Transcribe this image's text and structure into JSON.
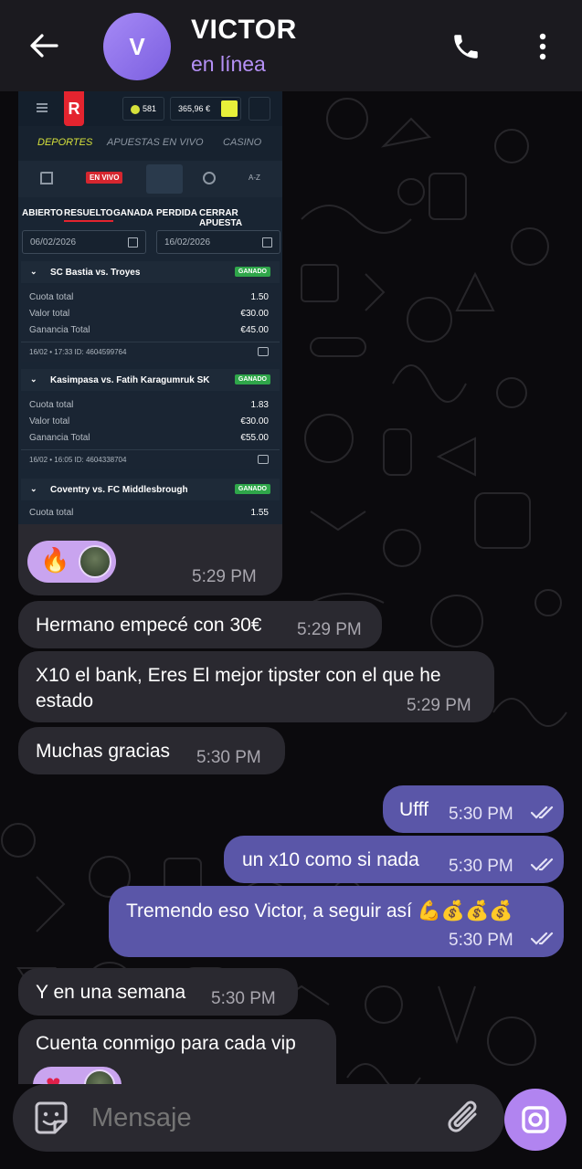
{
  "header": {
    "contact_name": "VICTOR",
    "status": "en línea",
    "avatar_initial": "V"
  },
  "screenshot": {
    "balance_points": "581",
    "balance_amount": "365,96 €",
    "nav": [
      "DEPORTES",
      "APUESTAS EN VIVO",
      "CASINO"
    ],
    "live_label": "EN VIVO",
    "az_label": "A-Z",
    "filters": [
      "ABIERTO",
      "RESUELTO",
      "GANADA",
      "PERDIDA",
      "CERRAR APUESTA"
    ],
    "date_from": "06/02/2026",
    "date_to": "16/02/2026",
    "bets": [
      {
        "match": "SC Bastia vs. Troyes",
        "status": "GANADO",
        "rows": [
          [
            "Cuota total",
            "1.50"
          ],
          [
            "Valor total",
            "€30.00"
          ],
          [
            "Ganancia Total",
            "€45.00"
          ]
        ],
        "meta": "16/02 • 17:33   ID: 4604599764"
      },
      {
        "match": "Kasimpasa vs. Fatih Karagumruk SK",
        "status": "GANADO",
        "rows": [
          [
            "Cuota total",
            "1.83"
          ],
          [
            "Valor total",
            "€30.00"
          ],
          [
            "Ganancia Total",
            "€55.00"
          ]
        ],
        "meta": "16/02 • 16:05   ID: 4604338704"
      },
      {
        "match": "Coventry vs. FC Middlesbrough",
        "status": "GANADO",
        "rows": [
          [
            "Cuota total",
            "1.55"
          ]
        ]
      }
    ]
  },
  "messages": {
    "image_time": "5:29 PM",
    "m1": {
      "text": "Hermano empecé con 30€",
      "time": "5:29 PM"
    },
    "m2": {
      "text": "X10 el bank, Eres El mejor tipster con el que he estado",
      "time": "5:29 PM"
    },
    "m3": {
      "text": "Muchas gracias",
      "time": "5:30 PM"
    },
    "m4": {
      "text": "Ufff",
      "time": "5:30 PM"
    },
    "m5": {
      "text": "un x10 como si nada",
      "time": "5:30 PM"
    },
    "m6": {
      "text": "Tremendo eso Victor, a seguir así 💪💰💰💰",
      "time": "5:30 PM"
    },
    "m7": {
      "text": "Y en una semana",
      "time": "5:30 PM"
    },
    "m8": {
      "text": "Cuenta conmigo para cada vip"
    }
  },
  "composer": {
    "placeholder": "Mensaje"
  },
  "colors": {
    "accent": "#b184f0",
    "outgoing_bubble": "#5a56a8",
    "incoming_bubble": "#2a2930"
  }
}
